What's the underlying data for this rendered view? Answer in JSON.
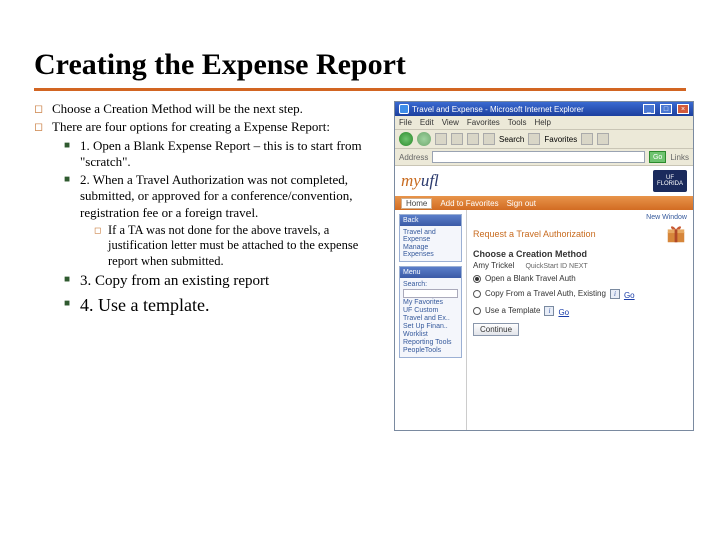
{
  "title": "Creating the Expense Report",
  "bullets": {
    "p1": "Choose a Creation Method will be the next step.",
    "p2": "There are four options for creating a Expense Report:",
    "s1": "1.  Open a Blank Expense Report – this is to start from \"scratch\".",
    "s2": "2.  When a Travel Authorization was not completed, submitted, or approved for a conference/convention, registration fee or a foreign travel.",
    "s2a": "If a TA was not done for the above travels, a justification letter must be attached to the expense report when submitted.",
    "s3": "3.  Copy from an existing report",
    "s4": "4.  Use a template."
  },
  "browser": {
    "title": "Travel and Expense - Microsoft Internet Explorer",
    "menu": [
      "File",
      "Edit",
      "View",
      "Favorites",
      "Tools",
      "Help"
    ],
    "toolbar": {
      "search": "Search",
      "favorites": "Favorites"
    },
    "address_label": "Address",
    "go": "Go",
    "links": "Links",
    "header_tabs": [
      "Home",
      "Add to Favorites",
      "Sign out"
    ],
    "myufl_my": "my",
    "myufl_ufl": "ufl",
    "uf_logo": "UF FLORIDA"
  },
  "sidebar": {
    "menu_hdr": "Menu",
    "menu_items": [
      "Search:",
      "—",
      "My Favorites",
      "UF Custom",
      "Travel and Ex..",
      "Set Up Finan..",
      "Worklist",
      "Reporting Tools",
      "PeopleTools"
    ],
    "back_hdr": "Back",
    "back_items": [
      "Travel and Expense",
      "Manage Expenses"
    ]
  },
  "main": {
    "new_window": "New Window",
    "request_label": "Request a Travel Authorization",
    "section_hdr": "Choose a Creation Method",
    "name": "Amy Trickel",
    "quick_id": "QuickStart ID   NEXT",
    "opt1": "Open a Blank Travel Auth",
    "opt2": "Copy From a Travel Auth, Existing",
    "opt3": "Use a Template",
    "go_link": "Go",
    "continue_btn": "Continue"
  }
}
